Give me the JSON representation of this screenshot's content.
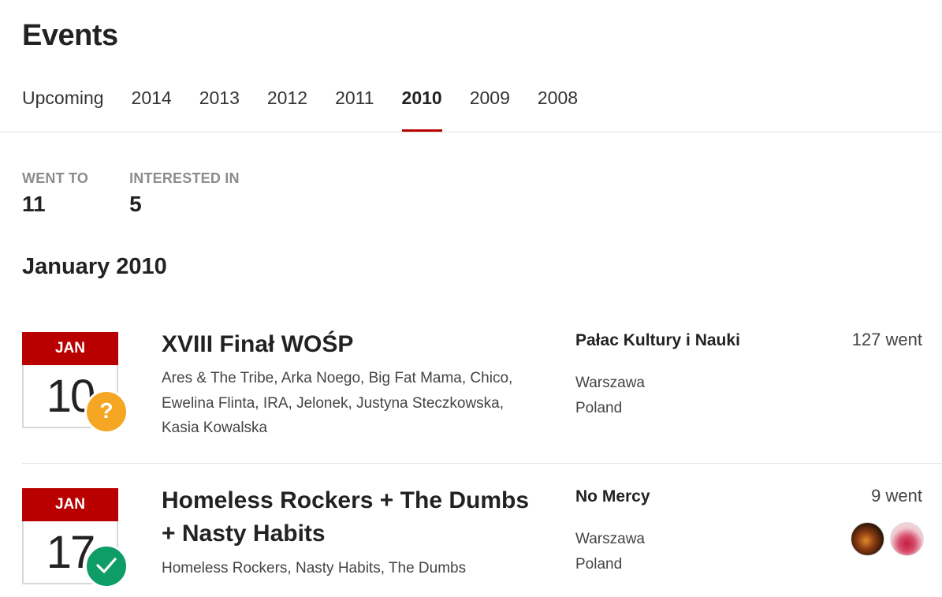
{
  "page": {
    "title": "Events"
  },
  "tabs": [
    {
      "label": "Upcoming",
      "active": false
    },
    {
      "label": "2014",
      "active": false
    },
    {
      "label": "2013",
      "active": false
    },
    {
      "label": "2012",
      "active": false
    },
    {
      "label": "2011",
      "active": false
    },
    {
      "label": "2010",
      "active": true
    },
    {
      "label": "2009",
      "active": false
    },
    {
      "label": "2008",
      "active": false
    }
  ],
  "stats": {
    "went_to": {
      "label": "WENT TO",
      "value": "11"
    },
    "interested_in": {
      "label": "INTERESTED IN",
      "value": "5"
    }
  },
  "month_heading": "January 2010",
  "events": [
    {
      "month": "JAN",
      "day": "10",
      "status": "interested",
      "status_icon": "question-mark-icon",
      "status_glyph": "?",
      "status_color": "#f5a623",
      "title": "XVIII Finał WOŚP",
      "lineup": "Ares & The Tribe, Arka Noego, Big Fat Mama, Chico, Ewelina Flinta, IRA, Jelonek, Justyna Steczkowska, Kasia Kowalska",
      "venue": "Pałac Kultury i Nauki",
      "city": "Warszawa",
      "country": "Poland",
      "went": "127 went"
    },
    {
      "month": "JAN",
      "day": "17",
      "status": "went",
      "status_icon": "checkmark-icon",
      "status_color": "#0f9d67",
      "title": "Homeless Rockers + The Dumbs + Nasty Habits",
      "lineup": "Homeless Rockers, Nasty Habits, The Dumbs",
      "venue": "No Mercy",
      "city": "Warszawa",
      "country": "Poland",
      "went": "9 went"
    }
  ],
  "colors": {
    "accent": "#b90000",
    "interested": "#f5a623",
    "went": "#0f9d67"
  }
}
